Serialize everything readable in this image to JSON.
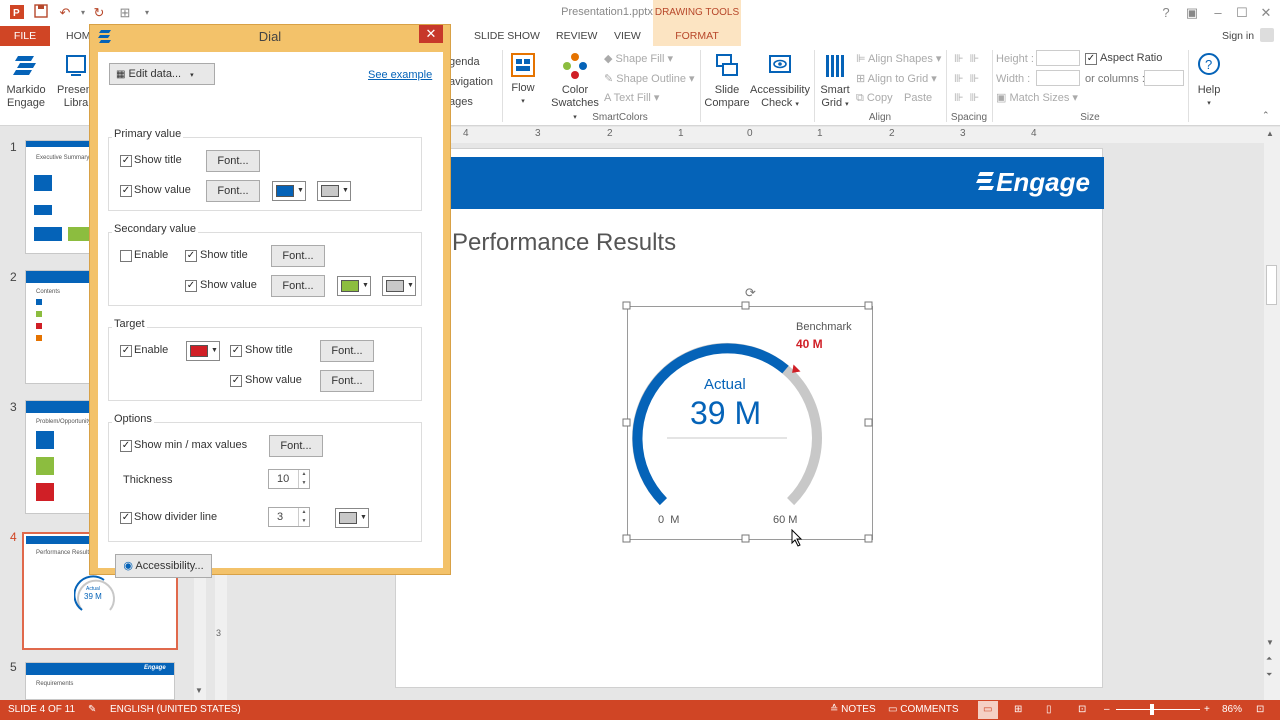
{
  "window": {
    "title": "Presentation1.pptx - PowerPoint",
    "contextual_tab_header": "DRAWING TOOLS",
    "sign_in": "Sign in"
  },
  "tabs": [
    "FILE",
    "HOM",
    "SLIDE SHOW",
    "REVIEW",
    "VIEW",
    "FORMAT"
  ],
  "ribbon": {
    "markido": {
      "line1": "Markido",
      "line2": "Engage"
    },
    "presentation_library": {
      "line1": "Present",
      "line2": "Libra"
    },
    "navigation_partial": [
      "genda",
      "avigation",
      "ages"
    ],
    "flow": "Flow",
    "color_swatches": {
      "line1": "Color",
      "line2": "Swatches"
    },
    "shape_fill": "Shape Fill",
    "shape_outline": "Shape Outline",
    "text_fill": "Text Fill",
    "smartcolors_label": "SmartColors",
    "slide_compare": {
      "line1": "Slide",
      "line2": "Compare"
    },
    "accessibility_check": {
      "line1": "Accessibility",
      "line2": "Check"
    },
    "smart_grid": {
      "line1": "Smart",
      "line2": "Grid"
    },
    "align_shapes": "Align Shapes",
    "align_to_grid": "Align to Grid",
    "copy": "Copy",
    "paste": "Paste",
    "align_label": "Align",
    "spacing_label": "Spacing",
    "height_label": "Height :",
    "width_label": "Width :",
    "aspect_ratio": "Aspect Ratio",
    "or_columns": "or columns :",
    "match_sizes": "Match Sizes",
    "size_label": "Size",
    "help": "Help"
  },
  "thumbnails": [
    {
      "num": "1",
      "caption": "Executive Summary"
    },
    {
      "num": "2",
      "caption": "Contents"
    },
    {
      "num": "3",
      "caption": "Problem/Opportunity"
    },
    {
      "num": "4",
      "caption": "Performance Results",
      "dial_value": "39 M",
      "dial_label": "Actual"
    },
    {
      "num": "5",
      "caption": "Requirements",
      "logo": "Engage"
    }
  ],
  "ruler_ticks": [
    "4",
    "3",
    "2",
    "1",
    "0",
    "1",
    "2",
    "3",
    "4"
  ],
  "slide": {
    "logo": "Engage",
    "title": "Performance Results",
    "dial": {
      "label": "Actual",
      "value": "39 M",
      "benchmark_label": "Benchmark",
      "benchmark_value": "40 M",
      "min_label": "0  M",
      "max_label": "60 M",
      "min": 0,
      "max": 60,
      "actual": 39,
      "target": 40
    }
  },
  "dialog": {
    "title": "Dial",
    "edit_data": "Edit data...",
    "see_example": "See example",
    "primary": {
      "label": "Primary value",
      "show_title": "Show title",
      "show_value": "Show value",
      "font": "Font...",
      "value_color": "#0563b8",
      "bg_color": "#c8c8c8"
    },
    "secondary": {
      "label": "Secondary value",
      "enable": "Enable",
      "show_title": "Show title",
      "show_value": "Show value",
      "font": "Font...",
      "value_color": "#8cbd3f",
      "bg_color": "#c8c8c8"
    },
    "target": {
      "label": "Target",
      "enable": "Enable",
      "color": "#d01f26",
      "show_title": "Show title",
      "show_value": "Show value",
      "font": "Font..."
    },
    "options": {
      "label": "Options",
      "show_min_max": "Show min / max values",
      "font": "Font...",
      "thickness_label": "Thickness",
      "thickness": "10",
      "show_divider": "Show divider line",
      "divider_value": "3",
      "divider_color": "#c8c8c8"
    },
    "accessibility": "Accessibility..."
  },
  "status": {
    "slide": "SLIDE 4 OF 11",
    "language": "ENGLISH (UNITED STATES)",
    "notes": "NOTES",
    "comments": "COMMENTS",
    "zoom": "86%"
  },
  "colors": {
    "accent_red": "#d04525",
    "slide_blue": "#0563b8",
    "dialog_frame": "#f3c26a"
  }
}
